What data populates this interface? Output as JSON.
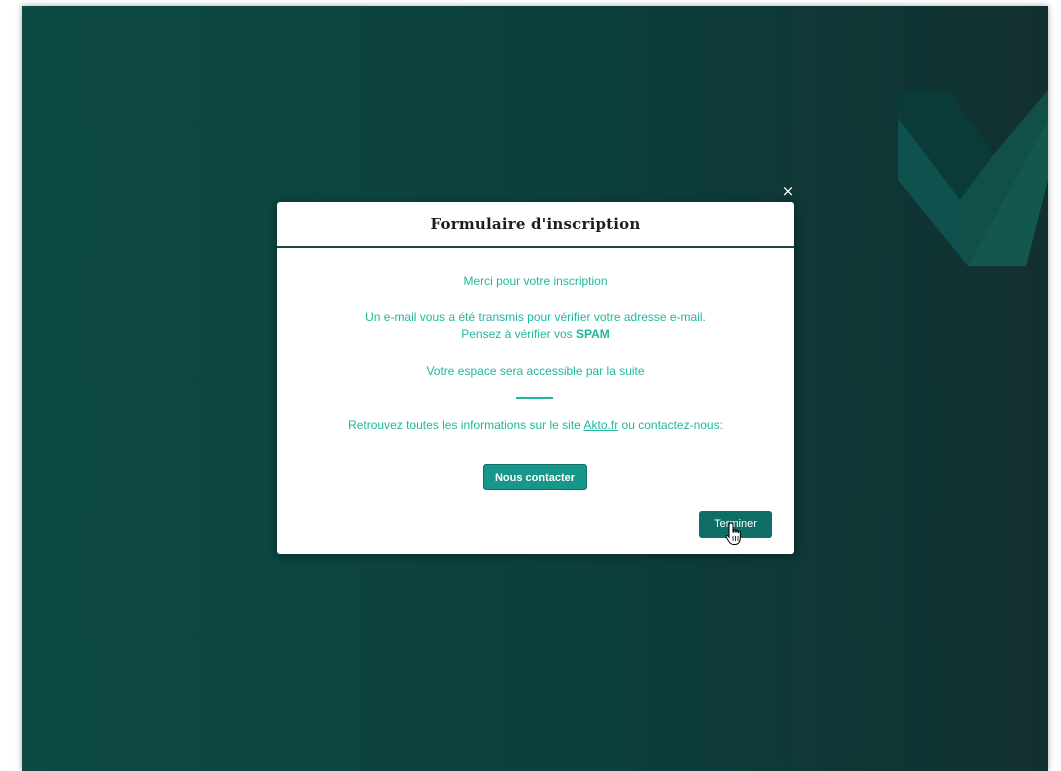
{
  "modal": {
    "close_glyph": "×",
    "title": "Formulaire d'inscription",
    "thanks": "Merci pour votre inscription",
    "mail_line1": "Un e-mail vous a été transmis pour vérifier votre adresse e-mail.",
    "mail_line2_prefix": "Pensez à vérifier vos ",
    "mail_line2_bold": "SPAM",
    "space_text": "Votre espace sera accessible par la suite",
    "info_prefix": "Retrouvez toutes les informations sur le site",
    "info_link": "Akto.fr",
    "info_suffix": " ou contactez-nous:",
    "contact_button": "Nous contacter",
    "finish_button": "Terminer"
  },
  "colors": {
    "background": "#0c3f3d",
    "accent": "#1fb89d",
    "button": "#17968a",
    "button_dark": "#0f6e65"
  },
  "icons": {
    "brand": "akto-v-logo-icon",
    "cursor": "hand-pointer-icon",
    "close": "close-icon"
  }
}
